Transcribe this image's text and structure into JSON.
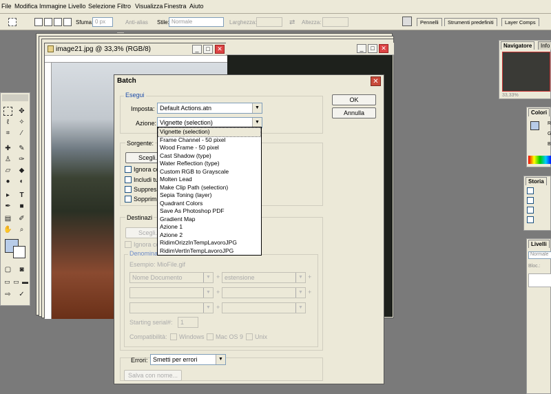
{
  "menubar": {
    "items": [
      "File",
      "Modifica",
      "Immagine",
      "Livello",
      "Selezione",
      "Filtro",
      "Visualizza",
      "Finestra",
      "Aiuto"
    ]
  },
  "options": {
    "sfuma_label": "Sfuma:",
    "sfuma_value": "0 px",
    "antialias_label": "Anti-alias",
    "stile_label": "Stile:",
    "stile_value": "Normale",
    "larghezza_label": "Larghezza:",
    "altezza_label": "Altezza:"
  },
  "palette_well": {
    "tabs": [
      "Pennelli",
      "Strumenti predefiniti",
      "Layer Comps"
    ]
  },
  "document": {
    "title": "image21.jpg @ 33,3% (RGB/8)"
  },
  "navigator": {
    "tabs": [
      "Navigatore",
      "Info"
    ],
    "zoom": "33,33%"
  },
  "colors_panel": {
    "tab": "Colori",
    "r": "R",
    "g": "G",
    "b": "B"
  },
  "history_panel": {
    "tab": "Storia"
  },
  "layers_panel": {
    "tab": "Livelli",
    "mode": "Normale",
    "lock": "Bloc.:"
  },
  "dialog": {
    "title": "Batch",
    "ok": "OK",
    "cancel": "Annulla",
    "esegui": {
      "group_label": "Esegui",
      "imposta_label": "Imposta:",
      "imposta_value": "Default Actions.atn",
      "azione_label": "Azione:",
      "azione_value": "Vignette (selection)"
    },
    "sorgente": {
      "label": "Sorgente:",
      "choose": "Scegli...",
      "checks": [
        "Ignora co",
        "Includi tu",
        "Suppress",
        "Sopprimi"
      ]
    },
    "destinazione": {
      "label": "Destinazi",
      "choose": "Scegli...",
      "check": "Ignora co",
      "naming_label": "Denomina",
      "example": "Esempio: MioFile.gif",
      "row1_left": "Nome Documento",
      "row1_right": "estensione",
      "starting_serial_label": "Starting serial#:",
      "starting_serial_value": "1",
      "compat_label": "Compatibilità:",
      "compat_windows": "Windows",
      "compat_mac": "Mac OS 9",
      "compat_unix": "Unix"
    },
    "errori": {
      "label": "Errori:",
      "value": "Smetti per errori",
      "save_as": "Salva con nome..."
    }
  },
  "action_list": {
    "items": [
      "Vignette (selection)",
      "Frame Channel - 50 pixel",
      "Wood Frame - 50 pixel",
      "Cast Shadow (type)",
      "Water Reflection (type)",
      "Custom RGB to Grayscale",
      "Molten Lead",
      "Make Clip Path (selection)",
      "Sepia Toning (layer)",
      "Quadrant Colors",
      "Save As Photoshop PDF",
      "Gradient Map",
      "Azione 1",
      "Azione 2",
      "RidimOrizzInTempLavoroJPG",
      "RidimVertInTempLavoroJPG"
    ],
    "selected_index": 0
  }
}
